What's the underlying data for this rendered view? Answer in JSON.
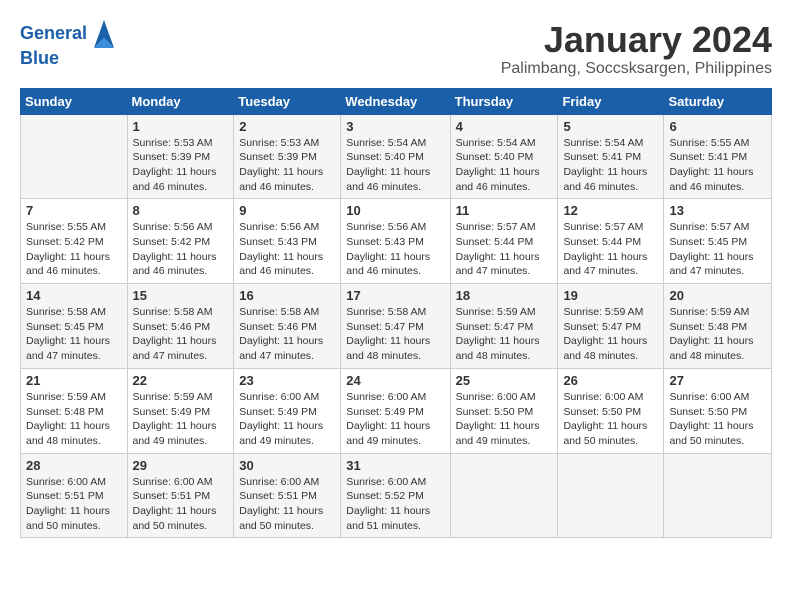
{
  "logo": {
    "line1": "General",
    "line2": "Blue"
  },
  "title": "January 2024",
  "location": "Palimbang, Soccsksargen, Philippines",
  "weekdays": [
    "Sunday",
    "Monday",
    "Tuesday",
    "Wednesday",
    "Thursday",
    "Friday",
    "Saturday"
  ],
  "weeks": [
    [
      {
        "day": "",
        "info": ""
      },
      {
        "day": "1",
        "info": "Sunrise: 5:53 AM\nSunset: 5:39 PM\nDaylight: 11 hours\nand 46 minutes."
      },
      {
        "day": "2",
        "info": "Sunrise: 5:53 AM\nSunset: 5:39 PM\nDaylight: 11 hours\nand 46 minutes."
      },
      {
        "day": "3",
        "info": "Sunrise: 5:54 AM\nSunset: 5:40 PM\nDaylight: 11 hours\nand 46 minutes."
      },
      {
        "day": "4",
        "info": "Sunrise: 5:54 AM\nSunset: 5:40 PM\nDaylight: 11 hours\nand 46 minutes."
      },
      {
        "day": "5",
        "info": "Sunrise: 5:54 AM\nSunset: 5:41 PM\nDaylight: 11 hours\nand 46 minutes."
      },
      {
        "day": "6",
        "info": "Sunrise: 5:55 AM\nSunset: 5:41 PM\nDaylight: 11 hours\nand 46 minutes."
      }
    ],
    [
      {
        "day": "7",
        "info": "Sunrise: 5:55 AM\nSunset: 5:42 PM\nDaylight: 11 hours\nand 46 minutes."
      },
      {
        "day": "8",
        "info": "Sunrise: 5:56 AM\nSunset: 5:42 PM\nDaylight: 11 hours\nand 46 minutes."
      },
      {
        "day": "9",
        "info": "Sunrise: 5:56 AM\nSunset: 5:43 PM\nDaylight: 11 hours\nand 46 minutes."
      },
      {
        "day": "10",
        "info": "Sunrise: 5:56 AM\nSunset: 5:43 PM\nDaylight: 11 hours\nand 46 minutes."
      },
      {
        "day": "11",
        "info": "Sunrise: 5:57 AM\nSunset: 5:44 PM\nDaylight: 11 hours\nand 47 minutes."
      },
      {
        "day": "12",
        "info": "Sunrise: 5:57 AM\nSunset: 5:44 PM\nDaylight: 11 hours\nand 47 minutes."
      },
      {
        "day": "13",
        "info": "Sunrise: 5:57 AM\nSunset: 5:45 PM\nDaylight: 11 hours\nand 47 minutes."
      }
    ],
    [
      {
        "day": "14",
        "info": "Sunrise: 5:58 AM\nSunset: 5:45 PM\nDaylight: 11 hours\nand 47 minutes."
      },
      {
        "day": "15",
        "info": "Sunrise: 5:58 AM\nSunset: 5:46 PM\nDaylight: 11 hours\nand 47 minutes."
      },
      {
        "day": "16",
        "info": "Sunrise: 5:58 AM\nSunset: 5:46 PM\nDaylight: 11 hours\nand 47 minutes."
      },
      {
        "day": "17",
        "info": "Sunrise: 5:58 AM\nSunset: 5:47 PM\nDaylight: 11 hours\nand 48 minutes."
      },
      {
        "day": "18",
        "info": "Sunrise: 5:59 AM\nSunset: 5:47 PM\nDaylight: 11 hours\nand 48 minutes."
      },
      {
        "day": "19",
        "info": "Sunrise: 5:59 AM\nSunset: 5:47 PM\nDaylight: 11 hours\nand 48 minutes."
      },
      {
        "day": "20",
        "info": "Sunrise: 5:59 AM\nSunset: 5:48 PM\nDaylight: 11 hours\nand 48 minutes."
      }
    ],
    [
      {
        "day": "21",
        "info": "Sunrise: 5:59 AM\nSunset: 5:48 PM\nDaylight: 11 hours\nand 48 minutes."
      },
      {
        "day": "22",
        "info": "Sunrise: 5:59 AM\nSunset: 5:49 PM\nDaylight: 11 hours\nand 49 minutes."
      },
      {
        "day": "23",
        "info": "Sunrise: 6:00 AM\nSunset: 5:49 PM\nDaylight: 11 hours\nand 49 minutes."
      },
      {
        "day": "24",
        "info": "Sunrise: 6:00 AM\nSunset: 5:49 PM\nDaylight: 11 hours\nand 49 minutes."
      },
      {
        "day": "25",
        "info": "Sunrise: 6:00 AM\nSunset: 5:50 PM\nDaylight: 11 hours\nand 49 minutes."
      },
      {
        "day": "26",
        "info": "Sunrise: 6:00 AM\nSunset: 5:50 PM\nDaylight: 11 hours\nand 50 minutes."
      },
      {
        "day": "27",
        "info": "Sunrise: 6:00 AM\nSunset: 5:50 PM\nDaylight: 11 hours\nand 50 minutes."
      }
    ],
    [
      {
        "day": "28",
        "info": "Sunrise: 6:00 AM\nSunset: 5:51 PM\nDaylight: 11 hours\nand 50 minutes."
      },
      {
        "day": "29",
        "info": "Sunrise: 6:00 AM\nSunset: 5:51 PM\nDaylight: 11 hours\nand 50 minutes."
      },
      {
        "day": "30",
        "info": "Sunrise: 6:00 AM\nSunset: 5:51 PM\nDaylight: 11 hours\nand 50 minutes."
      },
      {
        "day": "31",
        "info": "Sunrise: 6:00 AM\nSunset: 5:52 PM\nDaylight: 11 hours\nand 51 minutes."
      },
      {
        "day": "",
        "info": ""
      },
      {
        "day": "",
        "info": ""
      },
      {
        "day": "",
        "info": ""
      }
    ]
  ]
}
